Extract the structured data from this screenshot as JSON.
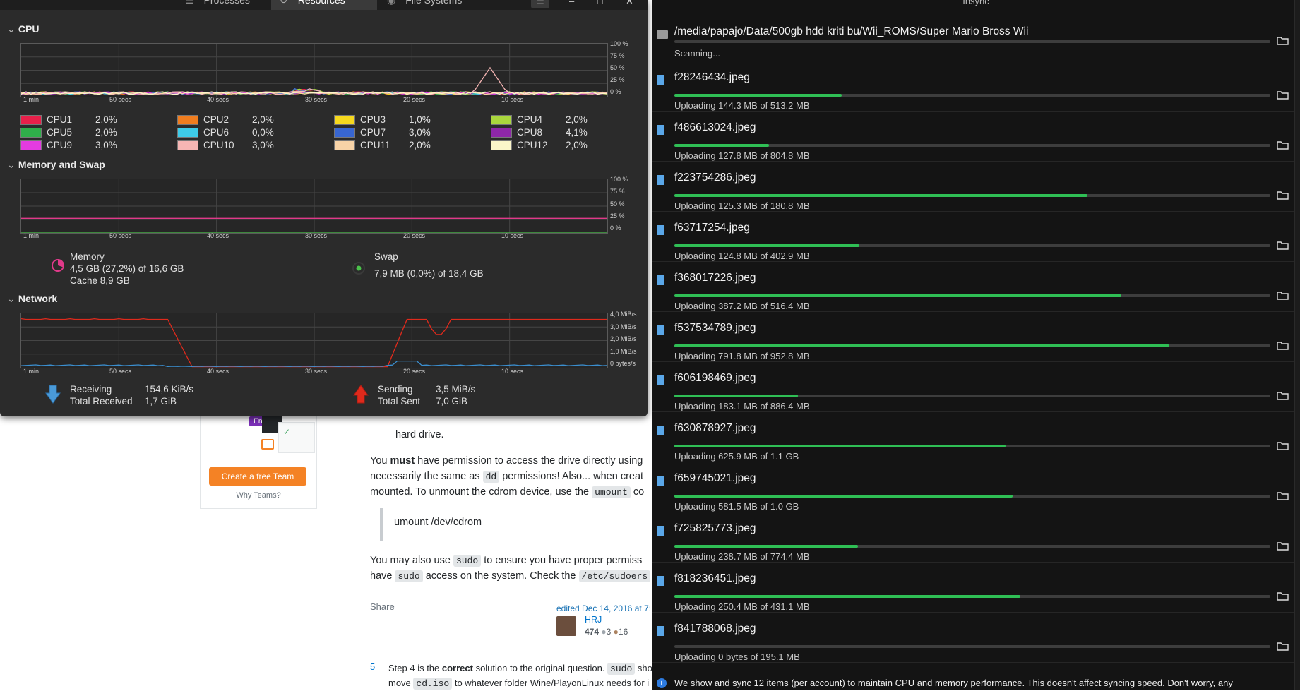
{
  "sysmon": {
    "tabs": [
      "Processes",
      "Resources",
      "File Systems"
    ],
    "active_tab": "Resources",
    "cpu": {
      "title": "CPU",
      "y_labels": [
        "100 %",
        "75 %",
        "50 %",
        "25 %",
        "0 %"
      ],
      "x_labels": [
        "1 min",
        "50 secs",
        "40 secs",
        "30 secs",
        "20 secs",
        "10 secs"
      ],
      "cores": [
        {
          "name": "CPU1",
          "value": "2,0%",
          "color": "#e8204a"
        },
        {
          "name": "CPU2",
          "value": "2,0%",
          "color": "#f07d1f"
        },
        {
          "name": "CPU3",
          "value": "1,0%",
          "color": "#f6d91e"
        },
        {
          "name": "CPU4",
          "value": "2,0%",
          "color": "#a9d63d"
        },
        {
          "name": "CPU5",
          "value": "2,0%",
          "color": "#2fae4a"
        },
        {
          "name": "CPU6",
          "value": "0,0%",
          "color": "#3ecbe8"
        },
        {
          "name": "CPU7",
          "value": "3,0%",
          "color": "#3866d1"
        },
        {
          "name": "CPU8",
          "value": "4,1%",
          "color": "#8e27a8"
        },
        {
          "name": "CPU9",
          "value": "3,0%",
          "color": "#e43be0"
        },
        {
          "name": "CPU10",
          "value": "3,0%",
          "color": "#f6b6b4"
        },
        {
          "name": "CPU11",
          "value": "2,0%",
          "color": "#f8d3a7"
        },
        {
          "name": "CPU12",
          "value": "2,0%",
          "color": "#fbf6c9"
        }
      ]
    },
    "memory": {
      "title": "Memory and Swap",
      "y_labels": [
        "100 %",
        "75 %",
        "50 %",
        "25 %",
        "0 %"
      ],
      "x_labels": [
        "1 min",
        "50 secs",
        "40 secs",
        "30 secs",
        "20 secs",
        "10 secs"
      ],
      "memory_label": "Memory",
      "memory_value": "4,5 GB (27,2%) of 16,6 GB",
      "cache_value": "Cache 8,9 GB",
      "swap_label": "Swap",
      "swap_value": "7,9 MB (0,0%) of 18,4 GB"
    },
    "network": {
      "title": "Network",
      "y_labels": [
        "4,0 MiB/s",
        "3,0 MiB/s",
        "2,0 MiB/s",
        "1,0 MiB/s",
        "0 bytes/s"
      ],
      "x_labels": [
        "1 min",
        "50 secs",
        "40 secs",
        "30 secs",
        "20 secs",
        "10 secs"
      ],
      "receiving_label": "Receiving",
      "receiving_value": "154,6 KiB/s",
      "total_received_label": "Total Received",
      "total_received_value": "1,7 GiB",
      "sending_label": "Sending",
      "sending_value": "3,5 MiB/s",
      "total_sent_label": "Total Sent",
      "total_sent_value": "7,0 GiB"
    }
  },
  "sync": {
    "title": "Insync",
    "folder_path": "/media/papajo/Data/500gb hdd kriti bu/Wii_ROMS/Super Mario Bross Wii",
    "folder_status": "Scanning...",
    "transfers": [
      {
        "name": "f28246434.jpeg",
        "status": "Uploading 144.3 MB of 513.2 MB",
        "progress": 0.281
      },
      {
        "name": "f486613024.jpeg",
        "status": "Uploading 127.8 MB of 804.8 MB",
        "progress": 0.159
      },
      {
        "name": "f223754286.jpeg",
        "status": "Uploading 125.3 MB of 180.8 MB",
        "progress": 0.693
      },
      {
        "name": "f63717254.jpeg",
        "status": "Uploading 124.8 MB of 402.9 MB",
        "progress": 0.31
      },
      {
        "name": "f368017226.jpeg",
        "status": "Uploading 387.2 MB of 516.4 MB",
        "progress": 0.75
      },
      {
        "name": "f537534789.jpeg",
        "status": "Uploading 791.8 MB of 952.8 MB",
        "progress": 0.831
      },
      {
        "name": "f606198469.jpeg",
        "status": "Uploading 183.1 MB of 886.4 MB",
        "progress": 0.207
      },
      {
        "name": "f630878927.jpeg",
        "status": "Uploading 625.9 MB of 1.1 GB",
        "progress": 0.556
      },
      {
        "name": "f659745021.jpeg",
        "status": "Uploading 581.5 MB of 1.0 GB",
        "progress": 0.568
      },
      {
        "name": "f725825773.jpeg",
        "status": "Uploading 238.7 MB of 774.4 MB",
        "progress": 0.308
      },
      {
        "name": "f818236451.jpeg",
        "status": "Uploading 250.4 MB of 431.1 MB",
        "progress": 0.581
      },
      {
        "name": "f841788068.jpeg",
        "status": "Uploading 0 bytes of 195.1 MB",
        "progress": 0.0
      }
    ],
    "footer_text": "We show and sync 12 items (per account) to maintain CPU and memory performance. This doesn't affect syncing speed. Don't worry, any",
    "accent_color": "#2fbf55"
  },
  "web": {
    "free_badge": "Free",
    "create_team_button": "Create a free Team",
    "why_teams_link": "Why Teams?",
    "line_hard_drive": "hard drive.",
    "para1_a": "You ",
    "para1_must": "must",
    "para1_b": " have permission to access the drive directly using",
    "para2_a": "necessarily the same as ",
    "para2_code": "dd",
    "para2_b": " permissions! Also... when creat",
    "para3_a": "mounted. To unmount the cdrom device, use the ",
    "para3_code": "umount",
    "para3_b": " co",
    "quote": "umount /dev/cdrom",
    "para4_a": "You may also use ",
    "para4_code": "sudo",
    "para4_b": " to ensure you have proper permiss",
    "para5_a": "have ",
    "para5_code": "sudo",
    "para5_b": " access on the system. Check the ",
    "para5_code2": "/etc/sudoers",
    "share": "Share",
    "edited": "edited Dec 14, 2016 at 7:",
    "user_name": "HRJ",
    "user_rep": "474",
    "user_silver": "3",
    "user_bronze": "16",
    "answer_number": "5",
    "answer_line1_a": "Step 4 is the ",
    "answer_line1_b": "correct",
    "answer_line1_c": " solution to the original question. ",
    "answer_line1_code": "sudo",
    "answer_line1_d": " sho",
    "answer_line2_a": "move ",
    "answer_line2_code": "cd.iso",
    "answer_line2_b": " to whatever folder Wine/PlayonLinux needs for i"
  }
}
